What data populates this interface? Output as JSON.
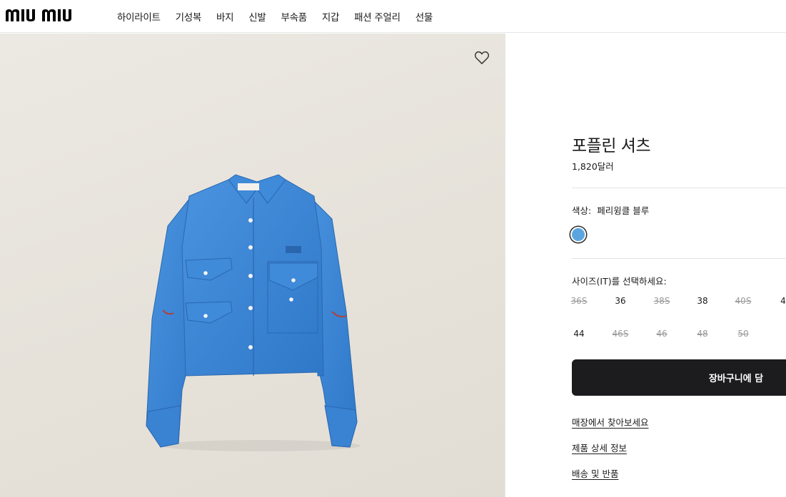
{
  "brand": {
    "logo_text": "miu miu"
  },
  "nav": {
    "items": [
      {
        "label": "하이라이트"
      },
      {
        "label": "기성복"
      },
      {
        "label": "바지"
      },
      {
        "label": "신발"
      },
      {
        "label": "부속품"
      },
      {
        "label": "지갑"
      },
      {
        "label": "패션 주얼리"
      },
      {
        "label": "선물"
      }
    ]
  },
  "product": {
    "name": "포플린 셔츠",
    "price": "1,820달러",
    "color_label": "색상:",
    "color_value": "페리윙클 블루",
    "swatch_color": "#5aa5e0",
    "shirt_color": "#3d86d6",
    "size_heading": "사이즈(IT)를 선택하세요:",
    "sizes": [
      {
        "label": "36S",
        "available": false
      },
      {
        "label": "36",
        "available": true
      },
      {
        "label": "38S",
        "available": false
      },
      {
        "label": "38",
        "available": true
      },
      {
        "label": "40S",
        "available": false
      },
      {
        "label": "4",
        "available": true
      },
      {
        "label": "44",
        "available": true
      },
      {
        "label": "46S",
        "available": false
      },
      {
        "label": "46",
        "available": false
      },
      {
        "label": "48",
        "available": false
      },
      {
        "label": "50",
        "available": false
      }
    ],
    "add_to_cart": "장바구니에 담",
    "links": [
      {
        "label": "매장에서 찾아보세요"
      },
      {
        "label": "제품 상세 정보"
      },
      {
        "label": "배송 및 반품"
      }
    ]
  },
  "icons": {
    "wishlist": "heart-outline-icon"
  }
}
